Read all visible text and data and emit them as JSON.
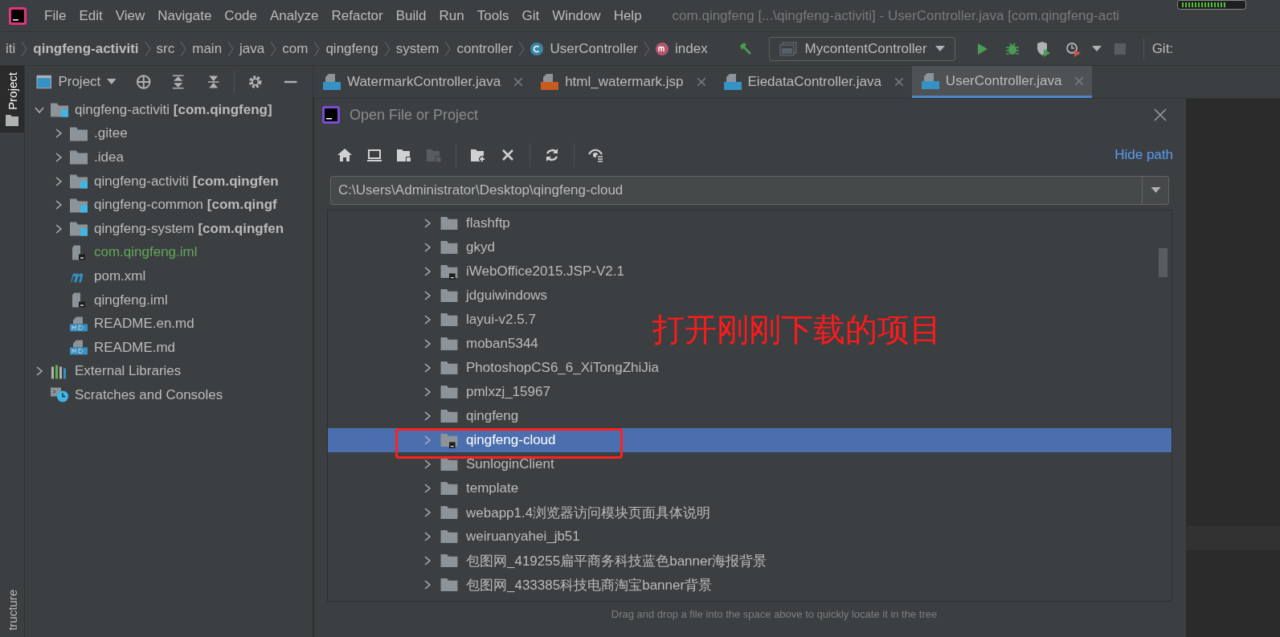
{
  "menu": [
    "File",
    "Edit",
    "View",
    "Navigate",
    "Code",
    "Analyze",
    "Refactor",
    "Build",
    "Run",
    "Tools",
    "Git",
    "Window",
    "Help"
  ],
  "window_title": "com.qingfeng [...\\qingfeng-activiti] - UserController.java [com.qingfeng-acti",
  "breadcrumbs": [
    {
      "label": "iti",
      "kind": "plain"
    },
    {
      "label": "qingfeng-activiti",
      "kind": "project"
    },
    {
      "label": "src",
      "kind": "plain"
    },
    {
      "label": "main",
      "kind": "plain"
    },
    {
      "label": "java",
      "kind": "plain"
    },
    {
      "label": "com",
      "kind": "plain"
    },
    {
      "label": "qingfeng",
      "kind": "plain"
    },
    {
      "label": "system",
      "kind": "plain"
    },
    {
      "label": "controller",
      "kind": "plain"
    },
    {
      "label": "UserController",
      "kind": "class"
    },
    {
      "label": "index",
      "kind": "method"
    }
  ],
  "run_config": "MycontentController",
  "git_label": "Git:",
  "side_tabs": [
    {
      "label": "Project",
      "selected": true
    },
    {
      "label": "tructure",
      "selected": false
    }
  ],
  "tool_window": {
    "title": "Project"
  },
  "tree": [
    {
      "label": "qingfeng-activiti **[com.qingfeng]**",
      "kind": "module",
      "expanded": true,
      "children": [
        {
          "label": ".gitee",
          "kind": "folder",
          "expanded": false
        },
        {
          "label": ".idea",
          "kind": "folder",
          "expanded": false
        },
        {
          "label": "qingfeng-activiti **[com.qingfen**",
          "kind": "module",
          "expanded": false
        },
        {
          "label": "qingfeng-common **[com.qingf**",
          "kind": "module",
          "expanded": false
        },
        {
          "label": "qingfeng-system **[com.qingfen**",
          "kind": "module",
          "expanded": false
        },
        {
          "label": "com.qingfeng.iml",
          "kind": "iml",
          "color": "#62a65b"
        },
        {
          "label": "pom.xml",
          "kind": "maven"
        },
        {
          "label": "qingfeng.iml",
          "kind": "iml"
        },
        {
          "label": "README.en.md",
          "kind": "md"
        },
        {
          "label": "README.md",
          "kind": "md"
        }
      ]
    },
    {
      "label": "External Libraries",
      "kind": "libraries",
      "expanded": false
    },
    {
      "label": "Scratches and Consoles",
      "kind": "scratches"
    }
  ],
  "tabs": [
    {
      "label": "WatermarkController.java",
      "kind": "java",
      "selected": false
    },
    {
      "label": "html_watermark.jsp",
      "kind": "jsp",
      "selected": false
    },
    {
      "label": "EiedataController.java",
      "kind": "java",
      "selected": false
    },
    {
      "label": "UserController.java",
      "kind": "java",
      "selected": true
    }
  ],
  "dialog": {
    "title": "Open File or Project",
    "hide_path": "Hide path",
    "path": "C:\\Users\\Administrator\\Desktop\\qingfeng-cloud",
    "files": [
      {
        "name": "flashftp",
        "kind": "folder",
        "selected": false
      },
      {
        "name": "gkyd",
        "kind": "folder",
        "selected": false
      },
      {
        "name": "iWebOffice2015.JSP-V2.1",
        "kind": "project",
        "selected": false
      },
      {
        "name": "jdguiwindows",
        "kind": "folder",
        "selected": false
      },
      {
        "name": "layui-v2.5.7",
        "kind": "folder",
        "selected": false
      },
      {
        "name": "moban5344",
        "kind": "folder",
        "selected": false
      },
      {
        "name": "PhotoshopCS6_6_XiTongZhiJia",
        "kind": "folder",
        "selected": false
      },
      {
        "name": "pmlxzj_15967",
        "kind": "folder",
        "selected": false
      },
      {
        "name": "qingfeng",
        "kind": "folder",
        "selected": false
      },
      {
        "name": "qingfeng-cloud",
        "kind": "project",
        "selected": true
      },
      {
        "name": "SunloginClient",
        "kind": "folder",
        "selected": false
      },
      {
        "name": "template",
        "kind": "folder",
        "selected": false
      },
      {
        "name": "webapp1.4浏览器访问模块页面具体说明",
        "kind": "folder",
        "selected": false
      },
      {
        "name": "weiruanyahei_jb51",
        "kind": "folder",
        "selected": false
      },
      {
        "name": "包图网_419255扁平商务科技蓝色banner海报背景",
        "kind": "folder",
        "selected": false
      },
      {
        "name": "包图网_433385科技电商淘宝banner背景",
        "kind": "folder",
        "selected": false
      }
    ],
    "hint": "Drag and drop a file into the space above to quickly locate it in the tree"
  },
  "annotation": "打开刚刚下载的项目"
}
